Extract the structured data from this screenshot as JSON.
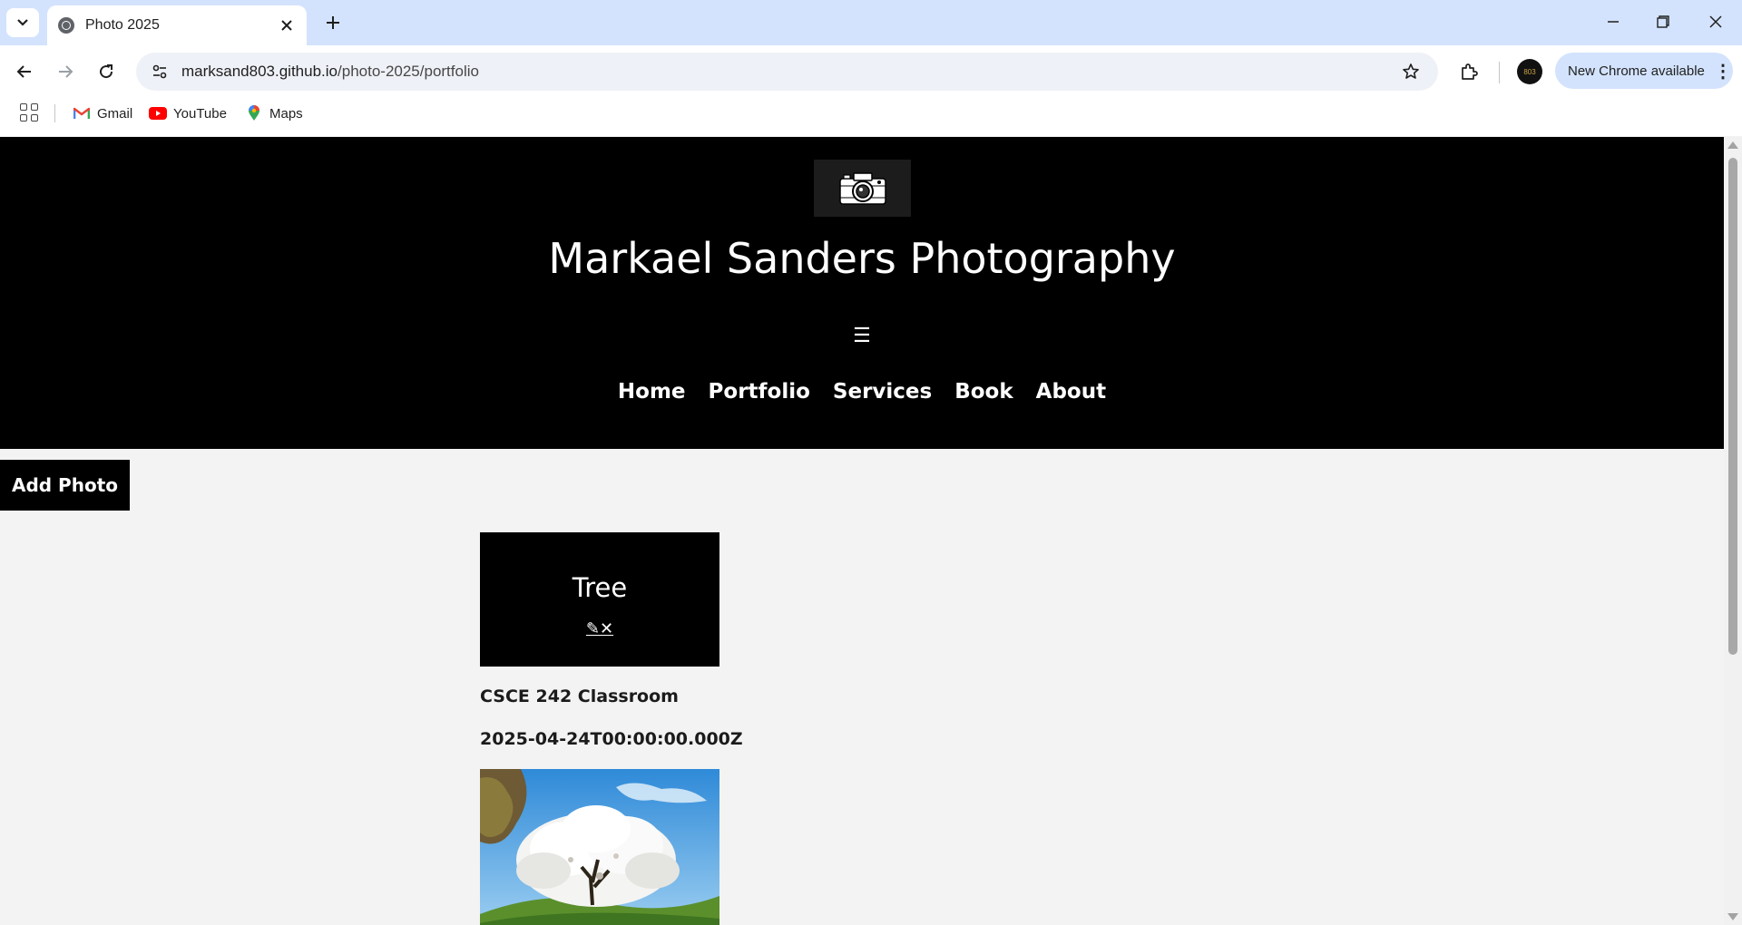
{
  "browser": {
    "tab_title": "Photo 2025",
    "url_host": "marksand803.github.io",
    "url_path": "/photo-2025/portfolio",
    "update_label": "New Chrome available",
    "profile_initials": "803",
    "bookmarks": [
      {
        "label": "Gmail",
        "icon": "gmail-icon"
      },
      {
        "label": "YouTube",
        "icon": "youtube-icon"
      },
      {
        "label": "Maps",
        "icon": "maps-icon"
      }
    ]
  },
  "site": {
    "title": "Markael Sanders Photography",
    "menu_icon": "☰",
    "nav": [
      "Home",
      "Portfolio",
      "Services",
      "Book",
      "About"
    ],
    "add_photo_label": "Add Photo"
  },
  "photos": [
    {
      "title": "Tree",
      "edit_icon": "✎",
      "delete_icon": "✕",
      "location": "CSCE 242 Classroom",
      "date": "2025-04-24T00:00:00.000Z"
    }
  ]
}
